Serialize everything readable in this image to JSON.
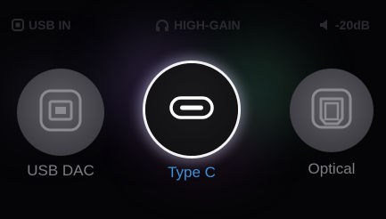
{
  "status_bar": {
    "input": {
      "label": "USB IN",
      "icon": "usb-square-icon"
    },
    "gain": {
      "label": "HIGH-GAIN",
      "icon": "headphones-icon"
    },
    "volume": {
      "label": "-20dB",
      "icon": "speaker-icon"
    }
  },
  "sources": [
    {
      "label": "USB DAC",
      "icon": "usb-b-port-icon",
      "selected": false
    },
    {
      "label": "Type C",
      "icon": "usb-c-port-icon",
      "selected": true
    },
    {
      "label": "Optical",
      "icon": "optical-port-icon",
      "selected": false
    }
  ],
  "colors": {
    "background": "#050507",
    "selected_label": "#3e8fd6",
    "unselected_label": "#7d7d82",
    "status_text": "#2a2a2e",
    "selected_ring": "#ffffff"
  }
}
